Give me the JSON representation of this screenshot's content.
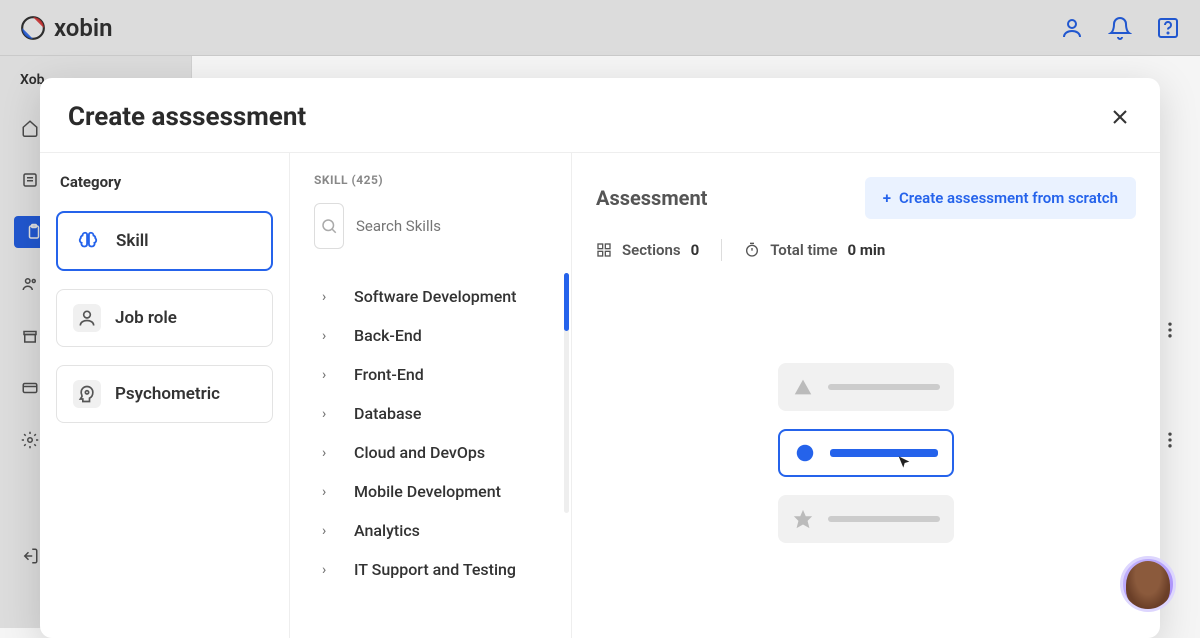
{
  "brand": "xobin",
  "sidebar_prefix": "Xob",
  "modal": {
    "title": "Create asssessment"
  },
  "category": {
    "heading": "Category",
    "items": [
      {
        "label": "Skill",
        "selected": true
      },
      {
        "label": "Job role",
        "selected": false
      },
      {
        "label": "Psychometric",
        "selected": false
      }
    ]
  },
  "skills": {
    "heading": "SKILL (425)",
    "search_placeholder": "Search Skills",
    "list": [
      "Software Development",
      "Back-End",
      "Front-End",
      "Database",
      "Cloud and DevOps",
      "Mobile Development",
      "Analytics",
      "IT Support and Testing"
    ]
  },
  "assessment": {
    "title": "Assessment",
    "scratch_label": "Create assessment from scratch",
    "sections_label": "Sections",
    "sections_value": "0",
    "total_time_label": "Total time",
    "total_time_value": "0 min"
  }
}
